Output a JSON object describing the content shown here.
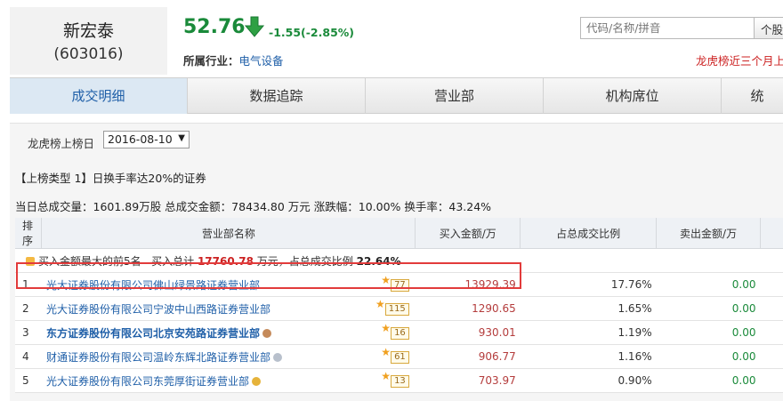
{
  "stock": {
    "name": "新宏泰",
    "code": "(603016)"
  },
  "quote": {
    "price": "52.76",
    "change": "-1.55(-2.85%)",
    "direction": "down",
    "color_down": "#1a8a3a"
  },
  "industry": {
    "label": "所属行业：",
    "value": "电气设备"
  },
  "search": {
    "placeholder": "代码/名称/拼音",
    "button_label": "个股"
  },
  "lhb_note": "龙虎榜近三个月上榜",
  "tabs": [
    {
      "label": "成交明细",
      "active": true
    },
    {
      "label": "数据追踪",
      "active": false
    },
    {
      "label": "营业部",
      "active": false
    },
    {
      "label": "机构席位",
      "active": false
    },
    {
      "label": "统",
      "active": false
    }
  ],
  "date_filter": {
    "label": "龙虎榜上榜日",
    "value": "2016-08-10"
  },
  "list_type": "【上榜类型 1】日换手率达20%的证券",
  "summary": "当日总成交量：1601.89万股 总成交金额：78434.80 万元 涨跌幅：10.00% 换手率：43.24%",
  "table": {
    "headers": [
      "排序",
      "营业部名称",
      "买入金额/万",
      "占总成交比例",
      "卖出金额/万",
      ""
    ],
    "section": {
      "prefix": "买入金额最大的前5名",
      "total_label": "买入总计",
      "total_value": "17760.78",
      "unit_text": "万元，占总成交比例",
      "pct": "22.64%"
    },
    "rows": [
      {
        "rank": "1",
        "name": "光大证券股份有限公司佛山绿景路证券营业部",
        "bold": false,
        "badge": "77",
        "medal": "",
        "buy": "13929.39",
        "pct": "17.76%",
        "sell": "0.00"
      },
      {
        "rank": "2",
        "name": "光大证券股份有限公司宁波中山西路证券营业部",
        "bold": false,
        "badge": "115",
        "medal": "",
        "buy": "1290.65",
        "pct": "1.65%",
        "sell": "0.00"
      },
      {
        "rank": "3",
        "name": "东方证券股份有限公司北京安苑路证券营业部",
        "bold": true,
        "badge": "16",
        "medal": "bronze",
        "buy": "930.01",
        "pct": "1.19%",
        "sell": "0.00"
      },
      {
        "rank": "4",
        "name": "财通证券股份有限公司温岭东辉北路证券营业部",
        "bold": false,
        "badge": "61",
        "medal": "silver",
        "buy": "906.77",
        "pct": "1.16%",
        "sell": "0.00"
      },
      {
        "rank": "5",
        "name": "光大证券股份有限公司东莞厚街证券营业部",
        "bold": false,
        "badge": "13",
        "medal": "gold",
        "buy": "703.97",
        "pct": "0.90%",
        "sell": "0.00"
      }
    ]
  }
}
